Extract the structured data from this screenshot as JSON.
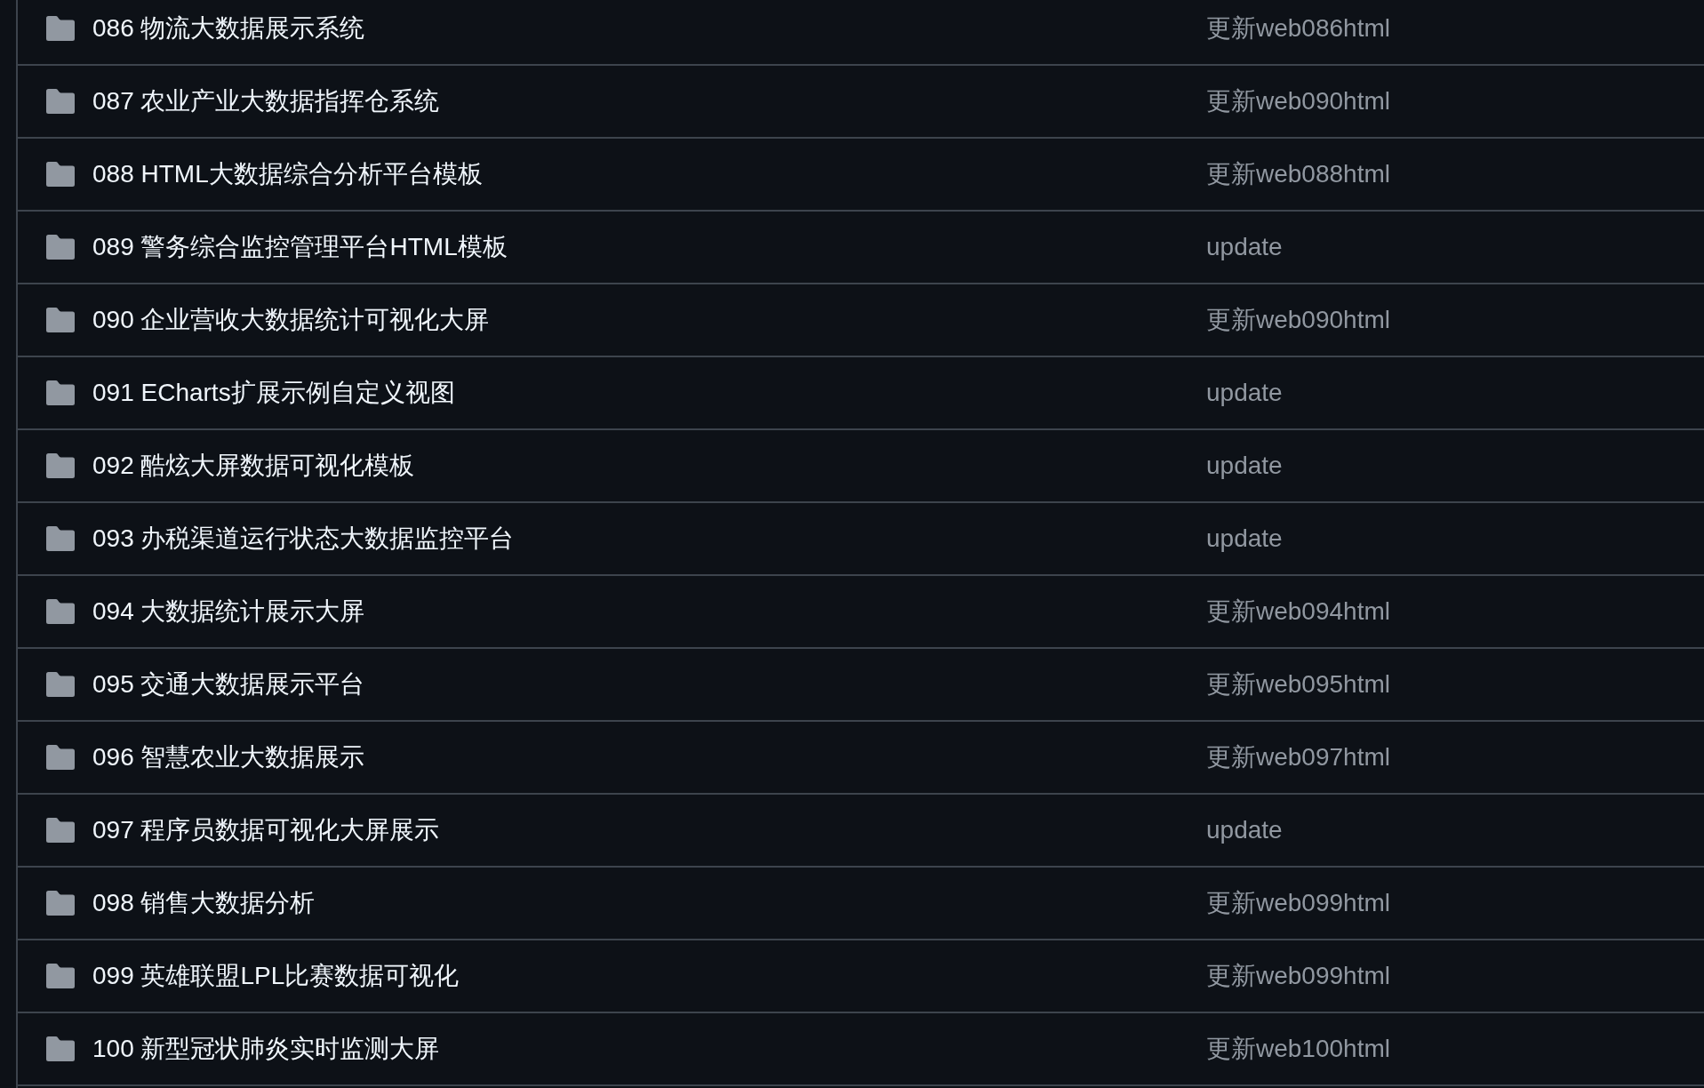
{
  "rows": [
    {
      "name": "086 物流大数据展示系统",
      "commit_message": "更新web086html"
    },
    {
      "name": "087 农业产业大数据指挥仓系统",
      "commit_message": "更新web090html"
    },
    {
      "name": "088 HTML大数据综合分析平台模板",
      "commit_message": "更新web088html"
    },
    {
      "name": "089 警务综合监控管理平台HTML模板",
      "commit_message": "update"
    },
    {
      "name": "090 企业营收大数据统计可视化大屏",
      "commit_message": "更新web090html"
    },
    {
      "name": "091 ECharts扩展示例自定义视图",
      "commit_message": "update"
    },
    {
      "name": "092 酷炫大屏数据可视化模板",
      "commit_message": "update"
    },
    {
      "name": "093 办税渠道运行状态大数据监控平台",
      "commit_message": "update"
    },
    {
      "name": "094 大数据统计展示大屏",
      "commit_message": "更新web094html"
    },
    {
      "name": "095 交通大数据展示平台",
      "commit_message": "更新web095html"
    },
    {
      "name": "096 智慧农业大数据展示",
      "commit_message": "更新web097html"
    },
    {
      "name": "097 程序员数据可视化大屏展示",
      "commit_message": "update"
    },
    {
      "name": "098 销售大数据分析",
      "commit_message": "更新web099html"
    },
    {
      "name": "099 英雄联盟LPL比赛数据可视化",
      "commit_message": "更新web099html"
    },
    {
      "name": "100 新型冠状肺炎实时监测大屏",
      "commit_message": "更新web100html"
    }
  ]
}
